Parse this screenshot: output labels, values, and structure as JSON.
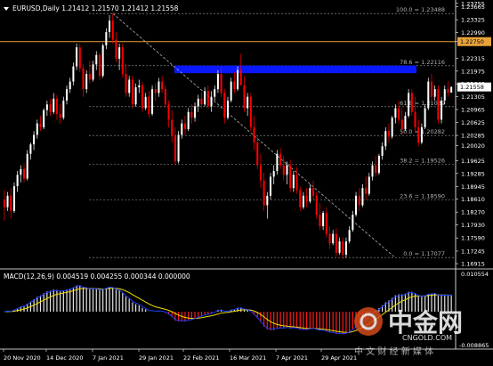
{
  "header": {
    "symbol_info": "EURUSD,Daily  1.21412 1.21570 1.21412 1.21558"
  },
  "colors": {
    "bg": "#000000",
    "bull": "#ffffff",
    "bear": "#ff0000",
    "axis": "#ffffff",
    "axis_text": "#ffffff",
    "fib_line": "#a0a0a0",
    "fib_text": "#b0b0b0",
    "orange_line": "#e8a33a",
    "price_label_bg": "#ffffff",
    "price_label_text": "#000000",
    "orange_label_bg": "#e8a33a",
    "zone": "#0a18ff",
    "trendline": "#b0b0b0",
    "macd_pos": "#e6e6e6",
    "macd_neg": "#ff1a1a",
    "macd_signal": "#f0e000",
    "macd_main": "#1a3cff"
  },
  "chart_data": {
    "type": "candlestick",
    "symbol": "EURUSD",
    "timeframe": "Daily",
    "last_price": 1.21558,
    "orange_level": 1.2275,
    "y_ticks": [
      1.16915,
      1.17245,
      1.1759,
      1.1793,
      1.1827,
      1.1861,
      1.18945,
      1.19285,
      1.19625,
      1.2002,
      1.20285,
      1.20625,
      1.20965,
      1.21305,
      1.2164,
      1.21975,
      1.22315,
      1.2275,
      1.2299,
      1.23325,
      1.23665,
      1.23755
    ],
    "y_tick_labels": [
      "1.16915",
      "1.17245",
      "1.17590",
      "1.17930",
      "1.18270",
      "1.18610",
      "1.18945",
      "1.19285",
      "1.19625",
      "1.20020",
      "1.20285",
      "1.20625",
      "1.20965",
      "1.21305",
      "1.21640",
      "1.21975",
      "1.22315",
      "1.22750",
      "1.22990",
      "1.23325",
      "1.23665",
      "1.23755"
    ],
    "x_labels": [
      "20 Nov 2020",
      "14 Dec 2020",
      "7 Jan 2021",
      "29 Jan 2021",
      "22 Feb 2021",
      "16 Mar 2021",
      "7 Apr 2021",
      "29 Apr 2021"
    ],
    "fib_levels": [
      {
        "label": "100.0 = 1.23488",
        "value": 1.23488
      },
      {
        "label": "78.6 = 1.22116",
        "value": 1.22116
      },
      {
        "label": "61.8 = 1.21039",
        "value": 1.21039
      },
      {
        "label": "50.0 = 1.20282",
        "value": 1.20282
      },
      {
        "label": "38.2 = 1.19526",
        "value": 1.19526
      },
      {
        "label": "23.6 = 1.18590",
        "value": 1.1859
      },
      {
        "label": "0.0 = 1.17077",
        "value": 1.17077
      }
    ],
    "zone": {
      "top": 1.2212,
      "bottom": 1.2192
    },
    "trendline": {
      "from_bar": 33,
      "from_price": 1.2349,
      "to_bar": 112,
      "to_price": 1.1701
    },
    "candles": [
      [
        1.186,
        1.1885,
        1.1805,
        1.184
      ],
      [
        1.184,
        1.188,
        1.183,
        1.187
      ],
      [
        1.187,
        1.189,
        1.181,
        1.183
      ],
      [
        1.183,
        1.1905,
        1.1825,
        1.1895
      ],
      [
        1.1895,
        1.1935,
        1.188,
        1.1925
      ],
      [
        1.1925,
        1.195,
        1.1905,
        1.194
      ],
      [
        1.194,
        1.1955,
        1.1905,
        1.1915
      ],
      [
        1.1915,
        1.199,
        1.191,
        1.198
      ],
      [
        1.198,
        1.201,
        1.1965,
        1.2005
      ],
      [
        1.2005,
        1.204,
        1.199,
        1.203
      ],
      [
        1.203,
        1.207,
        1.202,
        1.206
      ],
      [
        1.206,
        1.208,
        1.204,
        1.205
      ],
      [
        1.205,
        1.21,
        1.2045,
        1.2095
      ],
      [
        1.2095,
        1.212,
        1.208,
        1.211
      ],
      [
        1.211,
        1.2125,
        1.208,
        1.209
      ],
      [
        1.209,
        1.214,
        1.2085,
        1.2125
      ],
      [
        1.2125,
        1.2135,
        1.207,
        1.2085
      ],
      [
        1.2085,
        1.211,
        1.206,
        1.2075
      ],
      [
        1.2075,
        1.213,
        1.207,
        1.212
      ],
      [
        1.212,
        1.216,
        1.211,
        1.215
      ],
      [
        1.215,
        1.218,
        1.214,
        1.217
      ],
      [
        1.217,
        1.222,
        1.216,
        1.221
      ],
      [
        1.221,
        1.227,
        1.22,
        1.226
      ],
      [
        1.226,
        1.227,
        1.2195,
        1.2205
      ],
      [
        1.2205,
        1.2215,
        1.213,
        1.215
      ],
      [
        1.215,
        1.22,
        1.214,
        1.219
      ],
      [
        1.219,
        1.2225,
        1.2165,
        1.2175
      ],
      [
        1.2175,
        1.2225,
        1.217,
        1.2215
      ],
      [
        1.2215,
        1.225,
        1.22,
        1.224
      ],
      [
        1.224,
        1.2245,
        1.2175,
        1.2185
      ],
      [
        1.2185,
        1.227,
        1.218,
        1.2265
      ],
      [
        1.2265,
        1.231,
        1.2255,
        1.23
      ],
      [
        1.23,
        1.2345,
        1.2285,
        1.233
      ],
      [
        1.233,
        1.2349,
        1.227,
        1.228
      ],
      [
        1.228,
        1.23,
        1.222,
        1.223
      ],
      [
        1.223,
        1.227,
        1.22,
        1.226
      ],
      [
        1.226,
        1.227,
        1.218,
        1.219
      ],
      [
        1.219,
        1.2215,
        1.213,
        1.214
      ],
      [
        1.214,
        1.2185,
        1.213,
        1.2175
      ],
      [
        1.2175,
        1.2185,
        1.21,
        1.211
      ],
      [
        1.211,
        1.2165,
        1.2105,
        1.2155
      ],
      [
        1.2155,
        1.2175,
        1.214,
        1.216
      ],
      [
        1.216,
        1.217,
        1.209,
        1.21
      ],
      [
        1.21,
        1.214,
        1.2095,
        1.213
      ],
      [
        1.213,
        1.2145,
        1.2075,
        1.2085
      ],
      [
        1.2085,
        1.216,
        1.208,
        1.215
      ],
      [
        1.215,
        1.2165,
        1.212,
        1.214
      ],
      [
        1.214,
        1.218,
        1.213,
        1.217
      ],
      [
        1.217,
        1.2185,
        1.214,
        1.215
      ],
      [
        1.215,
        1.216,
        1.21,
        1.211
      ],
      [
        1.211,
        1.212,
        1.205,
        1.207
      ],
      [
        1.207,
        1.2095,
        1.201,
        1.203
      ],
      [
        1.203,
        1.205,
        1.195,
        1.196
      ],
      [
        1.196,
        1.204,
        1.1955,
        1.203
      ],
      [
        1.203,
        1.207,
        1.202,
        1.206
      ],
      [
        1.206,
        1.208,
        1.203,
        1.2045
      ],
      [
        1.2045,
        1.21,
        1.204,
        1.209
      ],
      [
        1.209,
        1.211,
        1.206,
        1.2075
      ],
      [
        1.2075,
        1.2115,
        1.2065,
        1.2105
      ],
      [
        1.2105,
        1.2135,
        1.209,
        1.2125
      ],
      [
        1.2125,
        1.214,
        1.21,
        1.211
      ],
      [
        1.211,
        1.2155,
        1.2105,
        1.2145
      ],
      [
        1.2145,
        1.216,
        1.21,
        1.2105
      ],
      [
        1.2105,
        1.2145,
        1.209,
        1.213
      ],
      [
        1.213,
        1.216,
        1.212,
        1.215
      ],
      [
        1.215,
        1.22,
        1.214,
        1.219
      ],
      [
        1.219,
        1.2205,
        1.213,
        1.214
      ],
      [
        1.214,
        1.215,
        1.206,
        1.2075
      ],
      [
        1.2075,
        1.213,
        1.207,
        1.212
      ],
      [
        1.212,
        1.218,
        1.2115,
        1.217
      ],
      [
        1.217,
        1.2195,
        1.214,
        1.215
      ],
      [
        1.215,
        1.221,
        1.2145,
        1.22
      ],
      [
        1.22,
        1.2243,
        1.218,
        1.216
      ],
      [
        1.216,
        1.2185,
        1.209,
        1.21
      ],
      [
        1.21,
        1.214,
        1.208,
        1.213
      ],
      [
        1.213,
        1.214,
        1.204,
        1.205
      ],
      [
        1.205,
        1.208,
        1.199,
        1.201
      ],
      [
        1.201,
        1.2025,
        1.194,
        1.195
      ],
      [
        1.195,
        1.198,
        1.189,
        1.191
      ],
      [
        1.191,
        1.193,
        1.183,
        1.1845
      ],
      [
        1.1845,
        1.188,
        1.181,
        1.187
      ],
      [
        1.187,
        1.193,
        1.186,
        1.192
      ],
      [
        1.192,
        1.195,
        1.19,
        1.1935
      ],
      [
        1.1935,
        1.199,
        1.1925,
        1.198
      ],
      [
        1.198,
        1.1995,
        1.194,
        1.195
      ],
      [
        1.195,
        1.1975,
        1.191,
        1.1925
      ],
      [
        1.1925,
        1.196,
        1.19,
        1.195
      ],
      [
        1.195,
        1.1965,
        1.188,
        1.189
      ],
      [
        1.189,
        1.1935,
        1.188,
        1.1925
      ],
      [
        1.1925,
        1.1945,
        1.1875,
        1.1885
      ],
      [
        1.1885,
        1.1895,
        1.183,
        1.184
      ],
      [
        1.184,
        1.188,
        1.1835,
        1.187
      ],
      [
        1.187,
        1.189,
        1.184,
        1.1855
      ],
      [
        1.1855,
        1.19,
        1.185,
        1.189
      ],
      [
        1.189,
        1.191,
        1.186,
        1.187
      ],
      [
        1.187,
        1.188,
        1.181,
        1.182
      ],
      [
        1.182,
        1.185,
        1.178,
        1.179
      ],
      [
        1.179,
        1.183,
        1.178,
        1.1825
      ],
      [
        1.1825,
        1.184,
        1.176,
        1.177
      ],
      [
        1.177,
        1.179,
        1.173,
        1.1745
      ],
      [
        1.1745,
        1.178,
        1.174,
        1.177
      ],
      [
        1.177,
        1.1785,
        1.171,
        1.172
      ],
      [
        1.172,
        1.176,
        1.1715,
        1.175
      ],
      [
        1.175,
        1.176,
        1.1704,
        1.1715
      ],
      [
        1.1715,
        1.176,
        1.1708,
        1.175
      ],
      [
        1.175,
        1.179,
        1.1745,
        1.178
      ],
      [
        1.178,
        1.183,
        1.1775,
        1.182
      ],
      [
        1.182,
        1.188,
        1.1815,
        1.187
      ],
      [
        1.187,
        1.189,
        1.183,
        1.1845
      ],
      [
        1.1845,
        1.19,
        1.184,
        1.189
      ],
      [
        1.189,
        1.192,
        1.186,
        1.1875
      ],
      [
        1.1875,
        1.193,
        1.187,
        1.192
      ],
      [
        1.192,
        1.196,
        1.191,
        1.195
      ],
      [
        1.195,
        1.1975,
        1.192,
        1.193
      ],
      [
        1.193,
        1.198,
        1.1925,
        1.1975
      ],
      [
        1.1975,
        1.201,
        1.1965,
        1.2
      ],
      [
        1.2,
        1.205,
        1.199,
        1.204
      ],
      [
        1.204,
        1.206,
        1.201,
        1.2025
      ],
      [
        1.2025,
        1.208,
        1.202,
        1.2075
      ],
      [
        1.2075,
        1.211,
        1.206,
        1.21
      ],
      [
        1.21,
        1.212,
        1.206,
        1.207
      ],
      [
        1.207,
        1.21,
        1.203,
        1.2045
      ],
      [
        1.2045,
        1.209,
        1.204,
        1.208
      ],
      [
        1.208,
        1.215,
        1.2075,
        1.214
      ],
      [
        1.214,
        1.215,
        1.208,
        1.209
      ],
      [
        1.209,
        1.213,
        1.204,
        1.205
      ],
      [
        1.205,
        1.207,
        1.2,
        1.201
      ],
      [
        1.201,
        1.206,
        1.2005,
        1.205
      ],
      [
        1.205,
        1.211,
        1.2045,
        1.21
      ],
      [
        1.21,
        1.218,
        1.2095,
        1.217
      ],
      [
        1.217,
        1.219,
        1.212,
        1.213
      ],
      [
        1.213,
        1.216,
        1.212,
        1.215
      ],
      [
        1.215,
        1.216,
        1.206,
        1.207
      ],
      [
        1.207,
        1.213,
        1.206,
        1.212
      ],
      [
        1.212,
        1.216,
        1.211,
        1.215
      ],
      [
        1.215,
        1.217,
        1.213,
        1.2141
      ],
      [
        1.2141,
        1.2157,
        1.2141,
        1.2156
      ]
    ],
    "macd": {
      "label": "MACD(12,26,9) 0.004519 0.004255 0.000344 0.000000",
      "params": [
        12,
        26,
        9
      ],
      "values": [
        0.004519,
        0.004255,
        0.000344,
        0.0
      ],
      "y_top_label": "0.010554",
      "y_bottom_label": "-0.008865"
    }
  },
  "watermark": {
    "brand_cn": "中金网",
    "brand_en": "CNGOLD.COM",
    "tagline_cn": "中 文 财 经 新 媒 体"
  }
}
